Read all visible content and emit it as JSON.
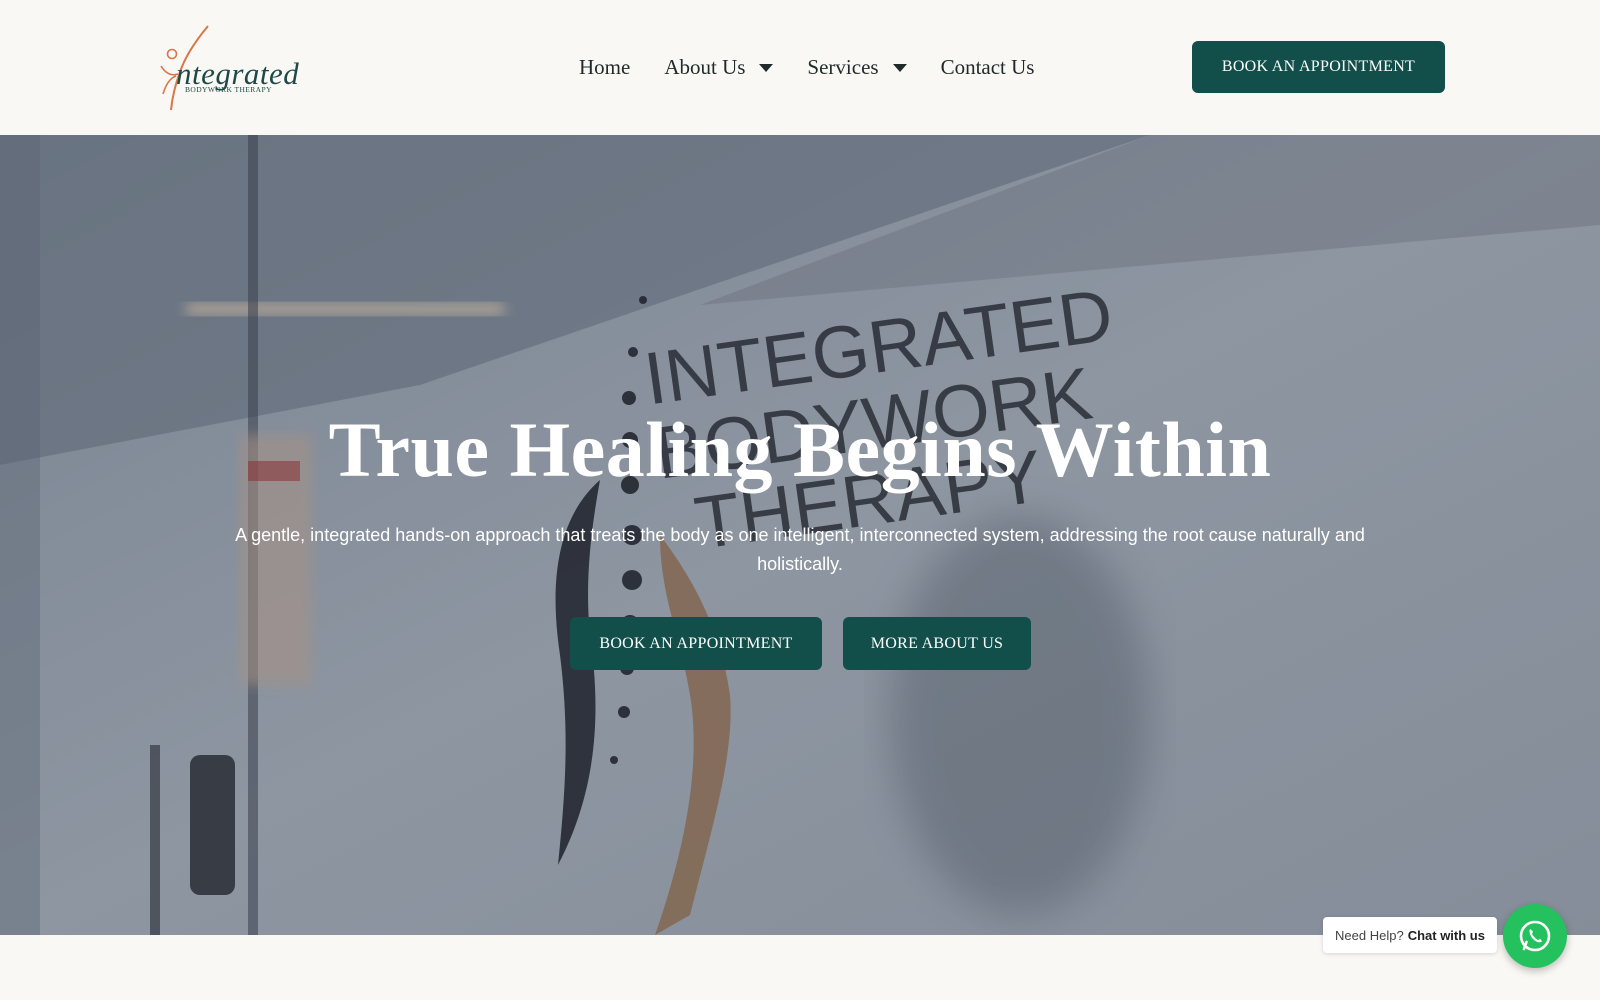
{
  "logo": {
    "wordmark": "ntegrated",
    "tagline": "BODYWORK THERAPY",
    "icon": "figure-i-icon"
  },
  "nav": {
    "items": [
      {
        "label": "Home",
        "has_dropdown": false
      },
      {
        "label": "About Us",
        "has_dropdown": true
      },
      {
        "label": "Services",
        "has_dropdown": true
      },
      {
        "label": "Contact Us",
        "has_dropdown": false
      }
    ],
    "cta_label": "BOOK AN APPOINTMENT"
  },
  "hero": {
    "title": "True Healing Begins Within",
    "subtitle": "A gentle, integrated hands-on approach that treats the body as one intelligent, interconnected system, addressing the root cause naturally and holistically.",
    "primary_button": "BOOK AN APPOINTMENT",
    "secondary_button": "MORE ABOUT US",
    "wall_sign": [
      "INTEGRATED",
      "BODYWORK",
      "THERAPY"
    ]
  },
  "chat": {
    "prefix": "Need Help?",
    "action": "Chat with us",
    "icon": "whatsapp-icon"
  },
  "colors": {
    "brand_teal": "#124f4b",
    "logo_accent": "#d9764a",
    "background": "#faf8f4",
    "whatsapp_green": "#25c15e"
  }
}
